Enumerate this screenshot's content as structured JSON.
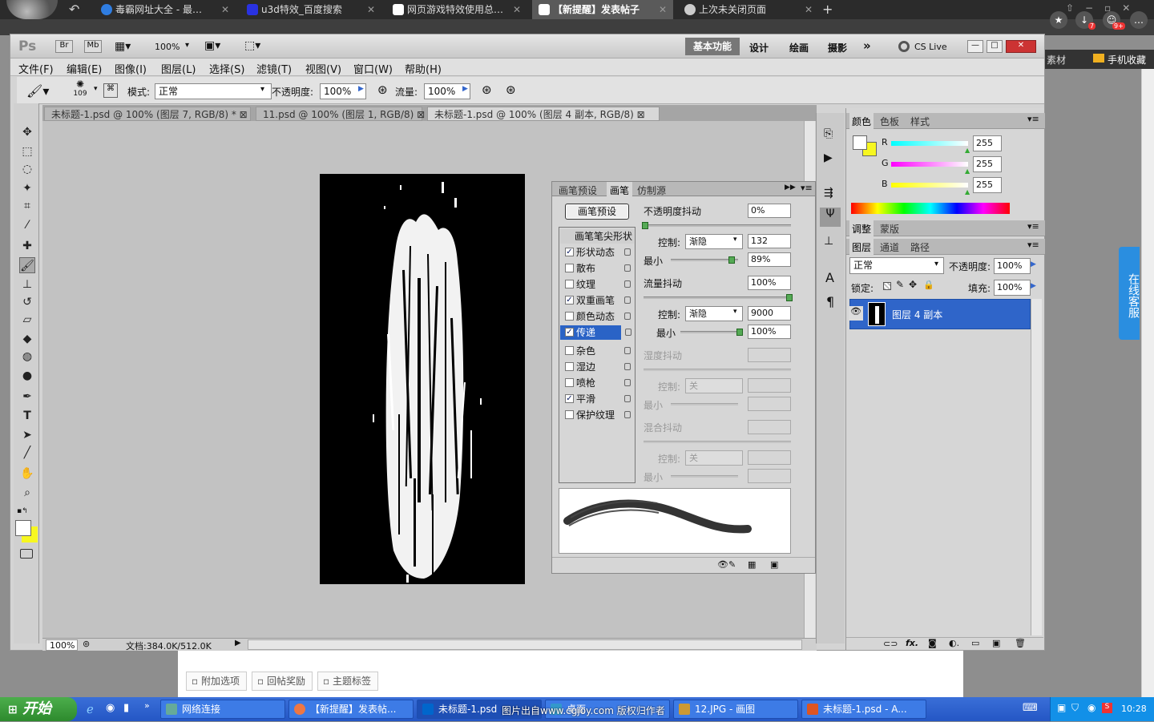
{
  "browser": {
    "tabs": [
      {
        "label": "毒霸网址大全 - 最…",
        "icon": "browser-k-icon",
        "color": "#2f7de1"
      },
      {
        "label": "u3d特效_百度搜索",
        "icon": "baidu-icon",
        "color": "#2932e1"
      },
      {
        "label": "网页游戏特效使用总…",
        "icon": "page-icon",
        "color": "#ffffff"
      },
      {
        "label": "【新提醒】发表帖子",
        "icon": "page-icon",
        "color": "#ffffff"
      },
      {
        "label": "上次未关闭页面",
        "icon": "gear-icon",
        "color": "#cccccc"
      }
    ],
    "right_links": [
      "素材",
      "手机收藏"
    ],
    "badges": [
      "7",
      "9+"
    ]
  },
  "ps": {
    "logo": "Ps",
    "app_buttons": [
      "Br",
      "Mb"
    ],
    "zoom": "100%",
    "workspaces": [
      "基本功能",
      "设计",
      "绘画",
      "摄影"
    ],
    "cs_live": "CS Live",
    "menu": [
      "文件(F)",
      "编辑(E)",
      "图像(I)",
      "图层(L)",
      "选择(S)",
      "滤镜(T)",
      "视图(V)",
      "窗口(W)",
      "帮助(H)"
    ],
    "options": {
      "brush_size": "109",
      "mode_label": "模式:",
      "mode_value": "正常",
      "opacity_label": "不透明度:",
      "opacity_value": "100%",
      "flow_label": "流量:",
      "flow_value": "100%"
    },
    "doc_tabs": [
      "未标题-1.psd @ 100% (图层 7, RGB/8) *",
      "11.psd @ 100% (图层 1, RGB/8)",
      "未标题-1.psd @ 100% (图层 4 副本, RGB/8)"
    ],
    "status": {
      "zoom": "100%",
      "doc": "文档:384.0K/512.0K"
    }
  },
  "brush_panel": {
    "tabs": [
      "画笔预设",
      "画笔",
      "仿制源"
    ],
    "preset_button": "画笔预设",
    "tip_shape": "画笔笔尖形状",
    "items": [
      {
        "label": "形状动态",
        "checked": true
      },
      {
        "label": "散布",
        "checked": false
      },
      {
        "label": "纹理",
        "checked": false
      },
      {
        "label": "双重画笔",
        "checked": true
      },
      {
        "label": "颜色动态",
        "checked": false
      },
      {
        "label": "传递",
        "checked": true
      },
      {
        "label": "杂色",
        "checked": false
      },
      {
        "label": "湿边",
        "checked": false
      },
      {
        "label": "喷枪",
        "checked": false
      },
      {
        "label": "平滑",
        "checked": true
      },
      {
        "label": "保护纹理",
        "checked": false
      }
    ],
    "opacity_jitter": {
      "label": "不透明度抖动",
      "value": "0%"
    },
    "control1": {
      "label": "控制:",
      "value": "渐隐",
      "number": "132"
    },
    "min1": {
      "label": "最小",
      "value": "89%"
    },
    "flow_jitter": {
      "label": "流量抖动",
      "value": "100%"
    },
    "control2": {
      "label": "控制:",
      "value": "渐隐",
      "number": "9000"
    },
    "min2": {
      "label": "最小",
      "value": "100%"
    },
    "wet_jitter": "湿度抖动",
    "control3": {
      "label": "控制:",
      "value": "关"
    },
    "min3": "最小",
    "mix_jitter": "混合抖动",
    "control4": {
      "label": "控制:",
      "value": "关"
    },
    "min4": "最小"
  },
  "color_panel": {
    "tabs": [
      "颜色",
      "色板",
      "样式"
    ],
    "channels": [
      {
        "label": "R",
        "value": "255"
      },
      {
        "label": "G",
        "value": "255"
      },
      {
        "label": "B",
        "value": "255"
      }
    ],
    "foreground": "#ffffff",
    "background": "#f7f720"
  },
  "adjust_panel": {
    "tabs": [
      "调整",
      "蒙版"
    ]
  },
  "layers_panel": {
    "tabs": [
      "图层",
      "通道",
      "路径"
    ],
    "blend": "正常",
    "opacity_label": "不透明度:",
    "opacity": "100%",
    "lock_label": "锁定:",
    "fill_label": "填充:",
    "fill": "100%",
    "layer_name": "图层 4 副本",
    "footer_icons": [
      "link-icon",
      "fx-icon",
      "mask-icon",
      "adjustment-icon",
      "group-icon",
      "new-layer-icon",
      "trash-icon"
    ]
  },
  "page_below": {
    "buttons": [
      "附加选项",
      "回帖奖励",
      "主题标签"
    ]
  },
  "service_widget": {
    "text": "在线客服"
  },
  "watermark": "图片出自www.cgjoy.com 版权归作者",
  "taskbar": {
    "start": "开始",
    "tasks": [
      {
        "label": "网络连接",
        "color": "#6a9"
      },
      {
        "label": "【新提醒】发表帖...",
        "color": "#e74"
      },
      {
        "label": "未标题-1.psd",
        "color": "#06c"
      },
      {
        "label": "桌面",
        "color": "#39c"
      },
      {
        "label": "12.JPG - 画图",
        "color": "#c93"
      },
      {
        "label": "未标题-1.psd - A...",
        "color": "#d52"
      }
    ],
    "clock": "10:28"
  }
}
